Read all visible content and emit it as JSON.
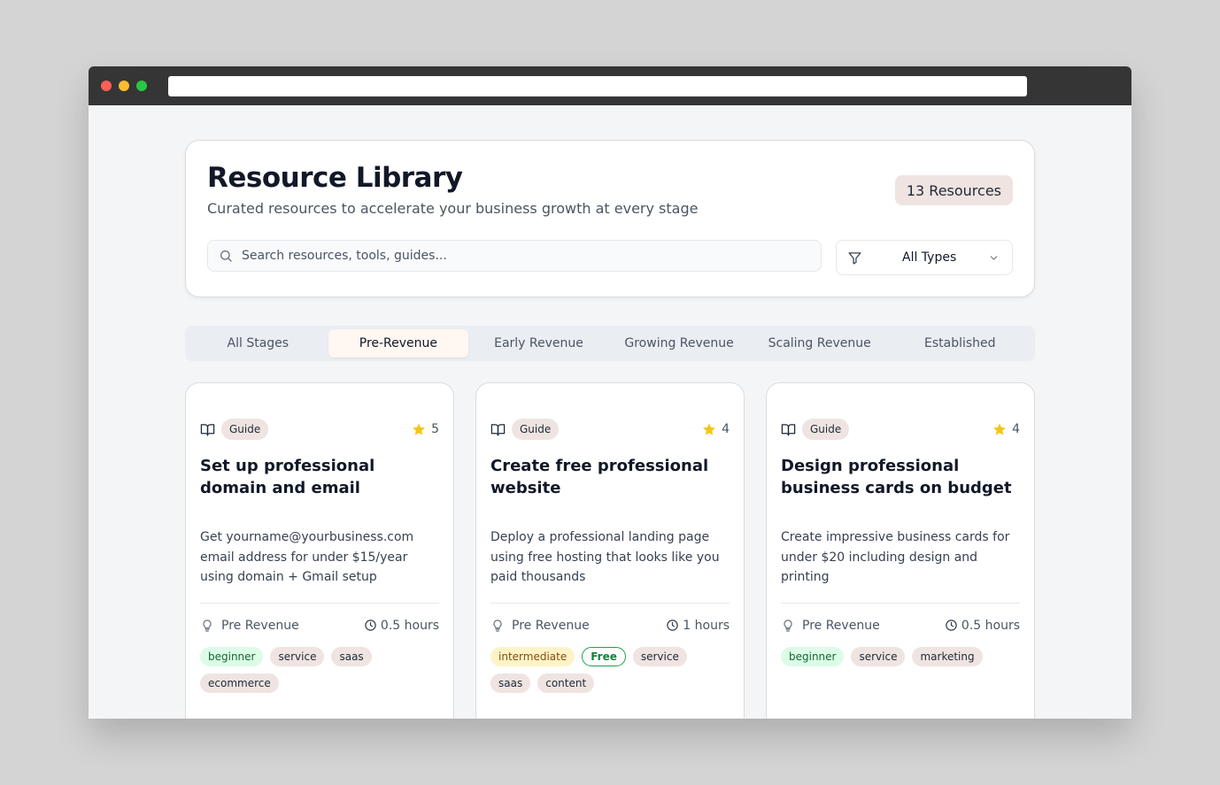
{
  "header": {
    "title": "Resource Library",
    "subtitle": "Curated resources to accelerate your business growth at every stage",
    "count_label": "13 Resources"
  },
  "search": {
    "placeholder": "Search resources, tools, guides..."
  },
  "type_filter": {
    "selected": "All Types"
  },
  "stage_tabs": [
    {
      "label": "All Stages",
      "active": false
    },
    {
      "label": "Pre-Revenue",
      "active": true
    },
    {
      "label": "Early Revenue",
      "active": false
    },
    {
      "label": "Growing Revenue",
      "active": false
    },
    {
      "label": "Scaling Revenue",
      "active": false
    },
    {
      "label": "Established",
      "active": false
    }
  ],
  "cards": [
    {
      "type": "Guide",
      "rating": "5",
      "title": "Set up professional domain and email",
      "description": "Get yourname@yourbusiness.com email address for under $15/year using domain + Gmail setup",
      "stage": "Pre Revenue",
      "duration": "0.5 hours",
      "tags": [
        "beginner",
        "service",
        "saas",
        "ecommerce"
      ]
    },
    {
      "type": "Guide",
      "rating": "4",
      "title": "Create free professional website",
      "description": "Deploy a professional landing page using free hosting that looks like you paid thousands",
      "stage": "Pre Revenue",
      "duration": "1 hours",
      "tags": [
        "intermediate",
        "Free",
        "service",
        "saas",
        "content"
      ]
    },
    {
      "type": "Guide",
      "rating": "4",
      "title": "Design professional business cards on budget",
      "description": "Create impressive business cards for under $20 including design and printing",
      "stage": "Pre Revenue",
      "duration": "0.5 hours",
      "tags": [
        "beginner",
        "service",
        "marketing"
      ]
    }
  ],
  "icons": {
    "search": "search-icon",
    "filter": "filter-icon",
    "chevron": "chevron-down-icon",
    "type": "book-icon",
    "rating": "star-icon",
    "stage": "lightbulb-icon",
    "duration": "clock-icon"
  },
  "colors": {
    "star": "#f5c518",
    "beginner_bg": "#dcfce7",
    "intermediate_bg": "#fef3c7",
    "free_border": "#16a34a"
  }
}
